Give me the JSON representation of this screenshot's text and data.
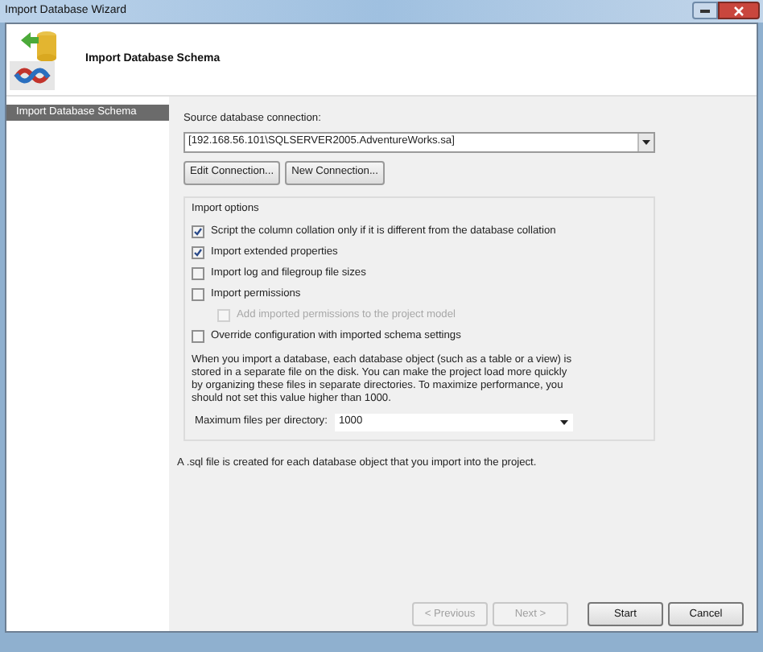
{
  "window": {
    "title": "Import Database Wizard"
  },
  "header": {
    "title": "Import Database Schema"
  },
  "sidebar": {
    "items": [
      {
        "label": "Import Database Schema",
        "selected": true
      }
    ]
  },
  "source": {
    "label": "Source database connection:",
    "value": "[192.168.56.101\\SQLSERVER2005.AdventureWorks.sa]"
  },
  "connection_buttons": [
    "Edit Connection...",
    "New Connection..."
  ],
  "import_options": {
    "title": "Import options",
    "options": [
      {
        "label": "Script the column collation only if it is different from the database collation",
        "checked": true,
        "disabled": false
      },
      {
        "label": "Import extended properties",
        "checked": true,
        "disabled": false
      },
      {
        "label": "Import log and filegroup file sizes",
        "checked": false,
        "disabled": false
      },
      {
        "label": "Import permissions",
        "checked": false,
        "disabled": false,
        "children": [
          {
            "label": "Add imported permissions to the project model",
            "checked": false,
            "disabled": true
          }
        ]
      },
      {
        "label": "Override configuration with imported schema settings",
        "checked": false,
        "disabled": false
      }
    ],
    "description": "When you import a database, each database object (such as a table or a view) is stored in a separate file on the disk. You can make the project load more quickly by organizing these files in separate directories. To maximize performance, you should not set this value higher than 1000.",
    "max_files": {
      "label": "Maximum files per directory:",
      "value": "1000"
    }
  },
  "note": "A .sql file is created for each database object that you import into the project.",
  "footer_buttons": [
    {
      "label": "< Previous",
      "disabled": true
    },
    {
      "label": "Next >",
      "disabled": true
    },
    {
      "label": "Start",
      "disabled": false
    },
    {
      "label": "Cancel",
      "disabled": false
    }
  ]
}
